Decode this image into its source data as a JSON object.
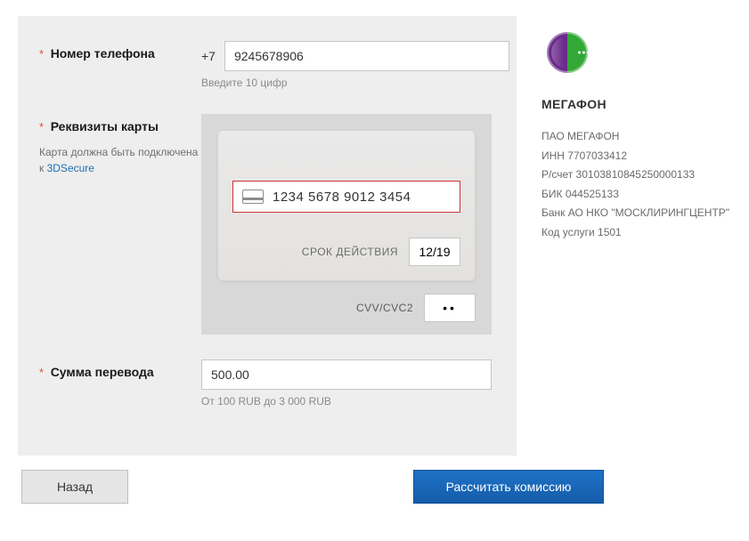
{
  "form": {
    "phone_label": "Номер телефона",
    "phone_prefix": "+7",
    "phone_value": "9245678906",
    "phone_hint": "Введите 10 цифр",
    "card_label": "Реквизиты карты",
    "card_sub_prefix": "Карта должна быть подключена к",
    "card_sub_link": "3DSecure",
    "card_number_value": "1234 5678 9012 3454",
    "expiry_label": "СРОК ДЕЙСТВИЯ",
    "expiry_value": "12/19",
    "cvv_label": "CVV/CVC2",
    "cvv_value": "••",
    "amount_label": "Сумма перевода",
    "amount_value": "500.00",
    "amount_hint": "От 100 RUB до 3 000 RUB"
  },
  "buttons": {
    "back": "Назад",
    "submit": "Рассчитать комиссию"
  },
  "sidebar": {
    "title": "МЕГАФОН",
    "lines": [
      "ПАО МЕГАФОН",
      "ИНН 7707033412",
      "Р/счет 30103810845250000133",
      "БИК 044525133",
      "Банк АО НКО \"МОСКЛИРИНГЦЕНТР\"",
      "Код услуги 1501"
    ]
  }
}
